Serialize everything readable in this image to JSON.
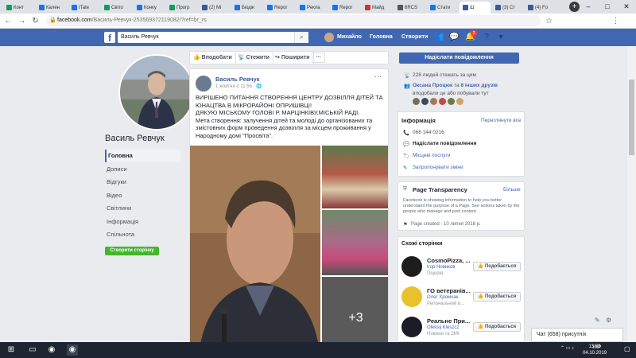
{
  "browser": {
    "tabs": [
      {
        "label": "Конт",
        "color": "#0f9d58"
      },
      {
        "label": "Кален",
        "color": "#1a73e8"
      },
      {
        "label": "ITate",
        "color": "#1a73e8"
      },
      {
        "label": "Світо",
        "color": "#0f9d58"
      },
      {
        "label": "Конку",
        "color": "#1a73e8"
      },
      {
        "label": "Прогр",
        "color": "#0f9d58"
      },
      {
        "label": "(2) Мі",
        "color": "#3b5998"
      },
      {
        "label": "Бюдж",
        "color": "#1a73e8"
      },
      {
        "label": "Repor",
        "color": "#1a73e8"
      },
      {
        "label": "Рекла",
        "color": "#1a73e8"
      },
      {
        "label": "Repor",
        "color": "#1a73e8"
      },
      {
        "label": "Майд",
        "color": "#d93025"
      },
      {
        "label": "6RCS",
        "color": "#555555"
      },
      {
        "label": "Стати",
        "color": "#1a73e8"
      },
      {
        "label": "Ш",
        "color": "#3b5998"
      },
      {
        "label": "(3) Ст",
        "color": "#3b5998"
      },
      {
        "label": "(4) Fo",
        "color": "#3b5998"
      }
    ],
    "new_tab": "+",
    "url_main": "facebook.com",
    "url_rest": "/Василь-Ревчук-253569372119082/?ref=br_rs"
  },
  "fb": {
    "logo": "f",
    "search_value": "Василь Ревчук",
    "user_name": "Михайло",
    "nav_home": "Головна",
    "nav_create": "Створити",
    "notif_count": "2"
  },
  "left": {
    "page_name": "Василь Ревчук",
    "nav": [
      "Головна",
      "Дописи",
      "Відгуки",
      "Відео",
      "Світлини",
      "Інформація",
      "Спільнота"
    ],
    "create_story": "Створити сторінку"
  },
  "actions": {
    "like": "Вподобати",
    "follow": "Стежити",
    "share": "Поширити",
    "more": "···"
  },
  "post": {
    "author": "Василь Ревчук",
    "time": "1 жовтня о 11:56 · ",
    "menu": "···",
    "text_lines": [
      "ВИРІШЕНО ПИТАННЯ СТВОРЕННЯ ЦЕНТРУ ДОЗВІЛЛЯ ДІТЕЙ ТА",
      "ЮНАЦТВА В МІКРОРАЙОНІ ОПРИШІВЦІ!",
      "ДЯКУЮ МІСЬКОМУ ГОЛОВІ Р. МАРЦІНКІВУ,МІСЬКІЙ РАДІ.",
      "Мета створення: залучення дітей та молоді до організованих та",
      "змістовних форм проведення дозвілля за місцем проживання у",
      "Народному домі \"Просвіта\"."
    ],
    "more_photos": "+3"
  },
  "right": {
    "send_message": "Надіслати повідомлення",
    "followers": "228 людей стежать за цим",
    "friends_like_prefix": "Оксана Процюк",
    "friends_like_mid": " та ",
    "friends_like_suffix": "8 інших друзів",
    "friends_like_note": "вподобали це або побували тут",
    "info_title": "Інформація",
    "info_edit": "Переглянути все",
    "phone": "068 144 0216",
    "send_msg2": "Надіслати повідомлення",
    "local_services": "Місцеві послуги",
    "suggest_edits": "Запропонувати зміни",
    "transparency_title": "Page Transparency",
    "transparency_more": "Більше",
    "transparency_text": "Facebook is showing information to help you better understand the purpose of a Page. See actions taken by the people who manage and post content.",
    "page_created": "Page created - 10 липня 2018 р.",
    "similar_title": "Схожі сторінки",
    "similar": [
      {
        "name": "CosmoPizza, ...",
        "sub1": "Ігор Новиков ",
        "sub2": "Піцерія",
        "like": "Подобається"
      },
      {
        "name": "ГО ветеранів...",
        "sub1": "Олег Хромчак ",
        "sub2": "Регіональний в...",
        "like": "Подобається"
      },
      {
        "name": "Реальне При...",
        "sub1": "Oleksij Kleszcz",
        "sub2": "Новини та ЗМІ",
        "like": "Подобається"
      }
    ],
    "chat": "Чат (658) присутніх"
  },
  "taskbar": {
    "time": "13:58",
    "date": "04.10.2019",
    "lang": "УКР"
  }
}
